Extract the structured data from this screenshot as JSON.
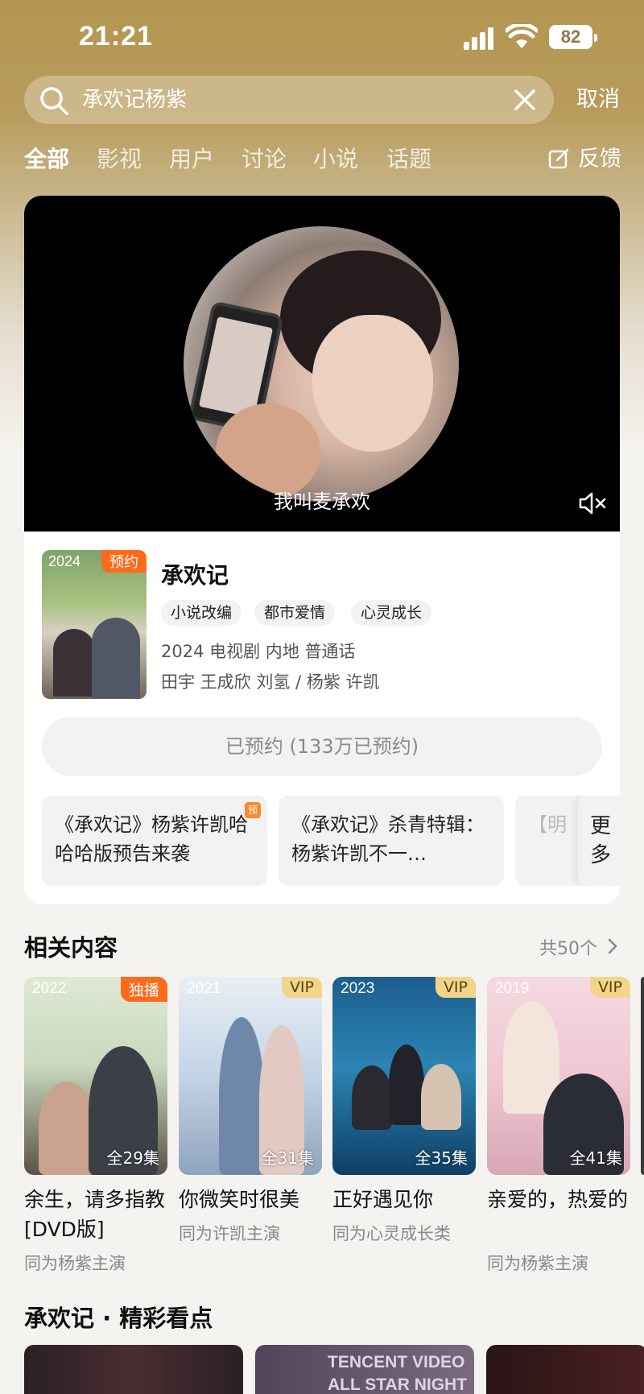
{
  "status_bar": {
    "time": "21:21",
    "battery": "82"
  },
  "search": {
    "query": "承欢记杨紫",
    "cancel_label": "取消"
  },
  "tabs": [
    "全部",
    "影视",
    "用户",
    "讨论",
    "小说",
    "话题"
  ],
  "feedback_label": "反馈",
  "video": {
    "subtitle": "我叫麦承欢"
  },
  "show": {
    "poster_year": "2024",
    "poster_badge": "预约",
    "title": "承欢记",
    "tags": [
      "小说改编",
      "都市爱情",
      "心灵成长"
    ],
    "meta": "2024 电视剧 内地 普通话",
    "cast": "田宇 王成欣 刘氢 / 杨紫 许凯",
    "reserve_label": "已预约 (133万已预约)"
  },
  "clips": [
    {
      "text": "《承欢记》杨紫许凯哈哈哈版预告来袭",
      "badge": "预"
    },
    {
      "text": "《承欢记》杀青特辑：杨紫许凯不一…"
    },
    {
      "text": "【明"
    }
  ],
  "clips_more_label": "更多",
  "related": {
    "title": "相关内容",
    "count": "共50个",
    "items": [
      {
        "year": "2022",
        "badge": "独播",
        "episodes": "全29集",
        "name": "余生，请多指教[DVD版]",
        "sub": "同为杨紫主演"
      },
      {
        "year": "2021",
        "badge": "VIP",
        "episodes": "全31集",
        "name": "你微笑时很美",
        "sub": "同为许凯主演"
      },
      {
        "year": "2023",
        "badge": "VIP",
        "episodes": "全35集",
        "name": "正好遇见你",
        "sub": "同为心灵成长类"
      },
      {
        "year": "2019",
        "badge": "VIP",
        "episodes": "全41集",
        "name": "亲爱的，热爱的",
        "sub": "同为杨紫主演"
      }
    ]
  },
  "highlights": {
    "title": "承欢记 · 精彩看点",
    "item2_text": "TENCENT VIDEO ALL STAR NIGHT"
  },
  "colors": {
    "accent_orange": "#ff6a1a",
    "vip_gold": "#f3d58a",
    "header_gold": "#b39650"
  }
}
